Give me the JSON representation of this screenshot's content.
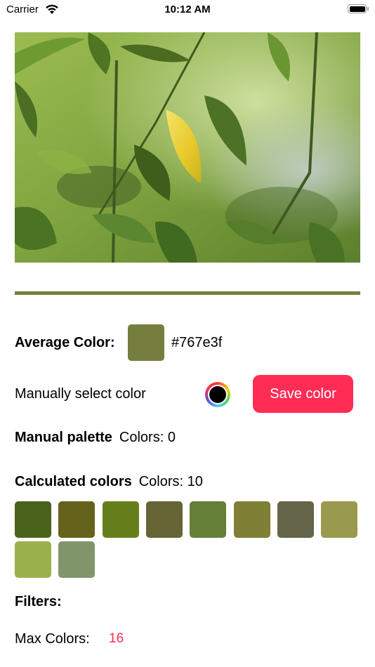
{
  "status_bar": {
    "carrier": "Carrier",
    "time": "10:12 AM",
    "wifi_icon": "wifi-icon",
    "battery_icon": "battery-icon",
    "battery_level": 1.0
  },
  "photo": {
    "description": "Green leafy plant with a single yellow leaf",
    "icon": "photo"
  },
  "average_color": {
    "label": "Average Color:",
    "hex": "#767e3f",
    "swatch_color": "#767e3f"
  },
  "manual_select": {
    "label": "Manually select color",
    "selected_color": "#000000",
    "save_button_label": "Save color"
  },
  "manual_palette": {
    "title": "Manual palette",
    "count_label": "Colors: 0"
  },
  "calculated_colors": {
    "title": "Calculated colors",
    "count_label": "Colors: 10",
    "swatches": [
      "#4b621b",
      "#65621b",
      "#667f1d",
      "#676435",
      "#657f36",
      "#7f7f35",
      "#646549",
      "#999a4d",
      "#9ab04c",
      "#80966a"
    ]
  },
  "filters": {
    "title": "Filters:",
    "max_colors_label": "Max Colors:",
    "max_colors_value": "16"
  },
  "colors": {
    "accent": "#ff2d55",
    "divider": "#767e3f"
  }
}
